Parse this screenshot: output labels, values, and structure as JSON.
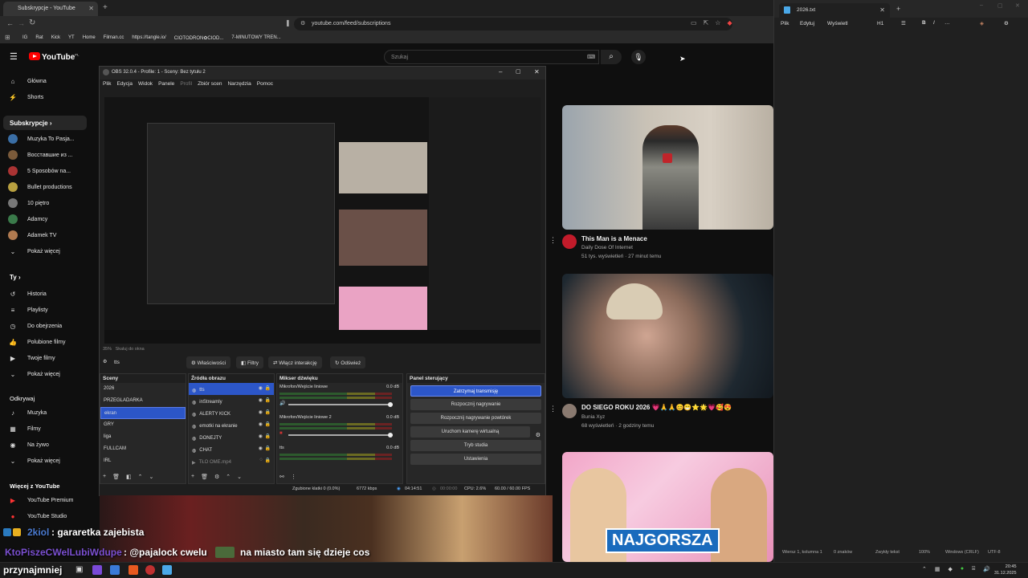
{
  "browser": {
    "tab_title": "Subskrypcje - YouTube",
    "url": "youtube.com/feed/subscriptions",
    "bookmarks": [
      "IG",
      "Rat",
      "Kick",
      "YT",
      "Home",
      "Filman.cc",
      "https://tangle.io/",
      "CIOTODRON✿CIOD...",
      "7-MINUTOWY TREN..."
    ]
  },
  "youtube": {
    "logo": "YouTube",
    "logo_region": "PL",
    "search_placeholder": "Szukaj",
    "sidebar": {
      "main": [
        {
          "icon": "home-icon",
          "label": "Główna"
        },
        {
          "icon": "shorts-icon",
          "label": "Shorts"
        }
      ],
      "subs_header": "Subskrypcje",
      "subs": [
        {
          "label": "Muzyka To Pasja...",
          "color": "#3a6ea5"
        },
        {
          "label": "Восставшие из ...",
          "color": "#7a5a3a"
        },
        {
          "label": "5 Sposobów na...",
          "color": "#aa3333"
        },
        {
          "label": "Bullet productions",
          "color": "#b8a040"
        },
        {
          "label": "10 piętro",
          "color": "#777777"
        },
        {
          "label": "Adamcy",
          "color": "#3a7a4a"
        },
        {
          "label": "Adamek TV",
          "color": "#b07a50"
        }
      ],
      "subs_more": "Pokaż więcej",
      "you_header": "Ty",
      "you": [
        {
          "icon": "history-icon",
          "label": "Historia"
        },
        {
          "icon": "playlist-icon",
          "label": "Playlisty"
        },
        {
          "icon": "clock-icon",
          "label": "Do obejrzenia"
        },
        {
          "icon": "like-icon",
          "label": "Polubione filmy"
        },
        {
          "icon": "video-icon",
          "label": "Twoje filmy"
        }
      ],
      "you_more": "Pokaż więcej",
      "explore_header": "Odkrywaj",
      "explore": [
        {
          "icon": "music-icon",
          "label": "Muzyka"
        },
        {
          "icon": "film-icon",
          "label": "Filmy"
        },
        {
          "icon": "live-icon",
          "label": "Na żywo"
        }
      ],
      "explore_more": "Pokaż więcej",
      "more_header": "Więcej z YouTube",
      "more": [
        {
          "icon": "yt-premium-icon",
          "label": "YouTube Premium"
        },
        {
          "icon": "yt-studio-icon",
          "label": "YouTube Studio"
        }
      ]
    },
    "videos": [
      {
        "title": "This Man is a Menace",
        "channel": "Daily Dose Of Internet",
        "meta": "51 tys. wyświetleń · 27 minut temu"
      },
      {
        "title": "DO SIEGO ROKU 2026 💗🙏🙏😊😁⭐🌟💗🥰😍",
        "channel": "Bunia Xyz",
        "meta": "68 wyświetleń · 2 godziny temu"
      },
      {
        "title": "NAJGORSZA",
        "channel": "",
        "meta": ""
      }
    ]
  },
  "obs": {
    "title": "OBS 32.0.4 - Profile: 1 - Sceny: Bez tytułu 2",
    "menu": [
      "Plik",
      "Edycja",
      "Widok",
      "Panele",
      "Profil",
      "Zbiór scen",
      "Narzędzia",
      "Pomoc"
    ],
    "selected_source": "tts",
    "toolbar": {
      "properties": "Właściwości",
      "filters": "Filtry",
      "interact": "Włącz interakcję",
      "refresh": "Odśwież"
    },
    "scenes_title": "Sceny",
    "scenes": [
      "2026",
      "PRZEGLADARKA",
      "ekran",
      "GRY",
      "liga",
      "FULLCAM",
      "IRL"
    ],
    "selected_scene": "ekran",
    "sources_title": "Źródła obrazu",
    "sources": [
      "tts",
      "inStreamly",
      "ALERTY KICK",
      "emotki na ekranie",
      "DONEJTY",
      "CHAT",
      "TŁO OME.mp4"
    ],
    "mixer_title": "Mikser dźwięku",
    "mixer": [
      {
        "name": "Mikrofon/Wejście liniowe",
        "db": "0.0 dB"
      },
      {
        "name": "Mikrofon/Wejście liniowe 2",
        "db": "0.0 dB"
      },
      {
        "name": "tts",
        "db": "0.0 dB"
      }
    ],
    "controls_title": "Panel sterujący",
    "controls": [
      "Zatrzymaj transmisję",
      "Rozpocznij nagrywanie",
      "Rozpocznij nagrywanie powtórek",
      "Uruchom kamerę wirtualną",
      "Tryb studia",
      "Ustawienia"
    ],
    "status": {
      "dropped": "Zgubione klatki 0 (0.0%)",
      "kbps": "6772 kbps",
      "live": "04:14:51",
      "rec": "00:00:00",
      "cpu": "CPU: 2.6%",
      "fps": "60.00 / 60.00 FPS"
    },
    "zoom": "35%",
    "zoom_label": "Skaluj do okna"
  },
  "notepad": {
    "tab": "2026.txt",
    "menu": [
      "Plik",
      "Edytuj",
      "Wyświetl"
    ],
    "heading": "H1",
    "status": {
      "pos": "Wiersz 1, kolumna 1",
      "chars": "0 znaków",
      "mode": "Zwykły tekst",
      "zoom": "100%",
      "eol": "Windows (CRLF)",
      "enc": "UTF-8"
    }
  },
  "overlay": {
    "line1_user": "2kiol",
    "line1_msg": ": gararetka zajebista",
    "line2_user": "KtoPiszeCWelLubiWdupe",
    "line2_msg": ": @pajalock cwelu",
    "line2_msg2": "na miasto tam się dzieje cos",
    "line3_user": "przynajmniej"
  },
  "taskbar": {
    "time": "20:45",
    "date": "31.12.2025"
  }
}
